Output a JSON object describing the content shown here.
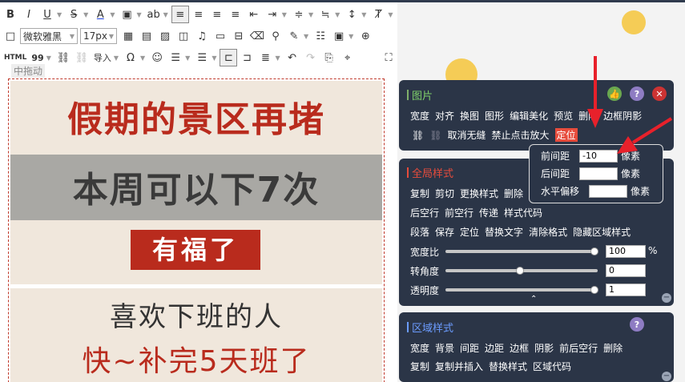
{
  "toolbar": {
    "font_family": "微软雅黑",
    "font_size": "17px",
    "html_label": "HTML",
    "import_label": "导入",
    "quote_label": "99"
  },
  "editor": {
    "drag_label": "中拖动",
    "headline1": "假期的景区再堵",
    "headline2": "本周可以下7次",
    "badge": "有福了",
    "line3": "喜欢下班的人",
    "line4": "快~补完5天班了"
  },
  "image_panel": {
    "title": "图片",
    "row1": [
      "宽度",
      "对齐",
      "换图",
      "图形",
      "编辑美化",
      "预览",
      "删除",
      "边框阴影"
    ],
    "row2": [
      "取消无缝",
      "禁止点击放大",
      "定位"
    ]
  },
  "position_popup": {
    "labels": [
      "前间距",
      "后间距",
      "水平偏移"
    ],
    "values": [
      "-10",
      "",
      ""
    ],
    "unit": "像素"
  },
  "global_panel": {
    "title": "全局样式",
    "row1": [
      "复制",
      "剪切",
      "更换样式",
      "删除"
    ],
    "row2": [
      "后空行",
      "前空行",
      "传递",
      "样式代码"
    ],
    "row3": [
      "段落",
      "保存",
      "定位",
      "替换文字",
      "清除格式",
      "隐藏区域样式"
    ],
    "sliders": [
      {
        "label": "宽度比",
        "value": "100",
        "unit": "%",
        "level": 1.0
      },
      {
        "label": "转角度",
        "value": "0",
        "unit": "",
        "level": 0.5
      },
      {
        "label": "透明度",
        "value": "1",
        "unit": "",
        "level": 1.0
      }
    ]
  },
  "region_panel": {
    "title": "区域样式",
    "row1": [
      "宽度",
      "背景",
      "间距",
      "边距",
      "边框",
      "阴影",
      "前后空行",
      "删除"
    ],
    "row2": [
      "复制",
      "复制并插入",
      "替换样式",
      "区域代码"
    ]
  },
  "colors": {
    "panel": "#2b3547",
    "accent_red": "#b92b1d",
    "arrow": "#e8212b"
  }
}
